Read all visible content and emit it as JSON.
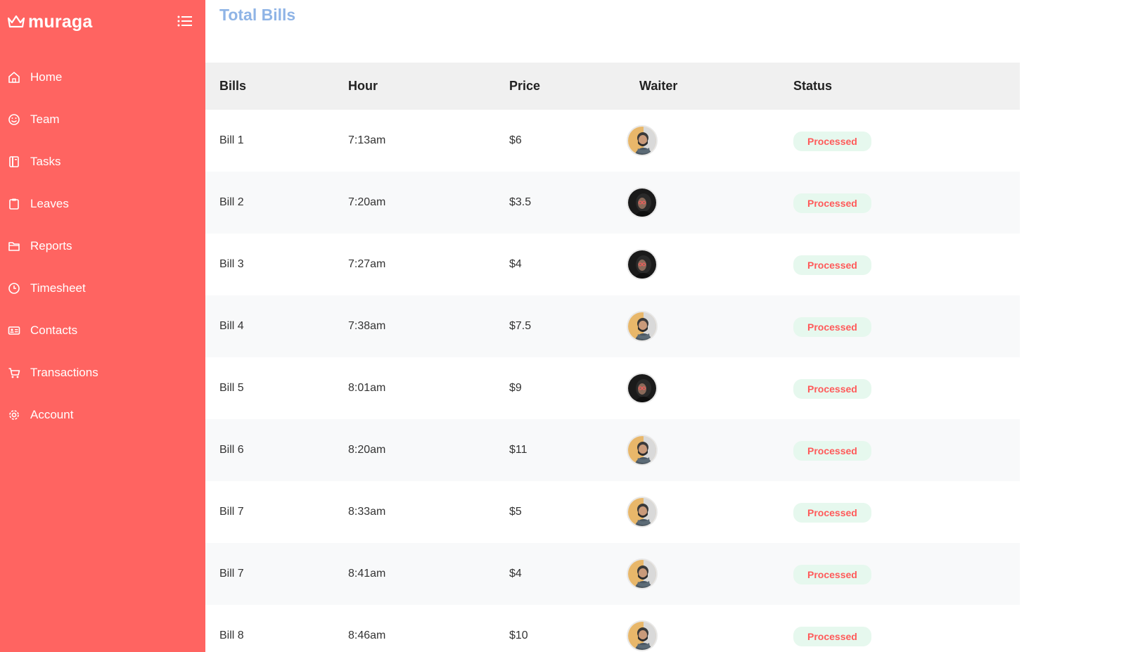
{
  "brand": {
    "name": "muraga",
    "icon": "crown-icon"
  },
  "sidebar": {
    "items": [
      {
        "label": "Home",
        "icon": "home-icon"
      },
      {
        "label": "Team",
        "icon": "smiley-icon"
      },
      {
        "label": "Tasks",
        "icon": "notebook-icon"
      },
      {
        "label": "Leaves",
        "icon": "clipboard-icon"
      },
      {
        "label": "Reports",
        "icon": "folder-icon"
      },
      {
        "label": "Timesheet",
        "icon": "clock-icon"
      },
      {
        "label": "Contacts",
        "icon": "id-card-icon"
      },
      {
        "label": "Transactions",
        "icon": "cart-icon"
      },
      {
        "label": "Account",
        "icon": "gear-icon"
      }
    ]
  },
  "main": {
    "title": "Total Bills"
  },
  "table": {
    "headers": {
      "bills": "Bills",
      "hour": "Hour",
      "price": "Price",
      "waiter": "Waiter",
      "status": "Status"
    },
    "rows": [
      {
        "bill": "Bill 1",
        "hour": "7:13am",
        "price": "$6",
        "waiter": "man-with-beard",
        "status": "Processed"
      },
      {
        "bill": "Bill 2",
        "hour": "7:20am",
        "price": "$3.5",
        "waiter": "woman-dark",
        "status": "Processed"
      },
      {
        "bill": "Bill 3",
        "hour": "7:27am",
        "price": "$4",
        "waiter": "woman-dark",
        "status": "Processed"
      },
      {
        "bill": "Bill 4",
        "hour": "7:38am",
        "price": "$7.5",
        "waiter": "man-with-beard",
        "status": "Processed"
      },
      {
        "bill": "Bill 5",
        "hour": "8:01am",
        "price": "$9",
        "waiter": "woman-dark",
        "status": "Processed"
      },
      {
        "bill": "Bill 6",
        "hour": "8:20am",
        "price": "$11",
        "waiter": "man-with-beard",
        "status": "Processed"
      },
      {
        "bill": "Bill 7",
        "hour": "8:33am",
        "price": "$5",
        "waiter": "man-with-beard",
        "status": "Processed"
      },
      {
        "bill": "Bill 7",
        "hour": "8:41am",
        "price": "$4",
        "waiter": "man-with-beard",
        "status": "Processed"
      },
      {
        "bill": "Bill 8",
        "hour": "8:46am",
        "price": "$10",
        "waiter": "man-with-beard",
        "status": "Processed"
      }
    ]
  },
  "colors": {
    "sidebar_bg": "#ff6461",
    "title": "#8fb4e6",
    "badge_bg": "#e6f8ee",
    "badge_text": "#ff5a5a",
    "header_bg": "#f0f0f0"
  }
}
